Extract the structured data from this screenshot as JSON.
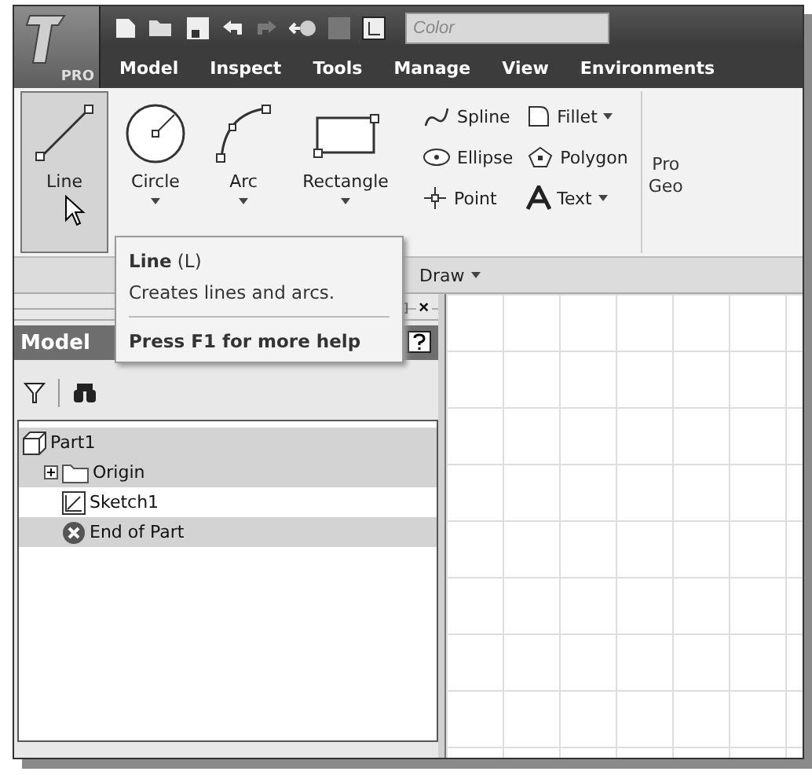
{
  "app_button": {
    "label": "PRO"
  },
  "quick_access": {
    "color_field": {
      "placeholder": "Color"
    }
  },
  "tabs": [
    {
      "label": "Model"
    },
    {
      "label": "Inspect"
    },
    {
      "label": "Tools"
    },
    {
      "label": "Manage"
    },
    {
      "label": "View"
    },
    {
      "label": "Environments"
    }
  ],
  "ribbon": {
    "large_tools": [
      {
        "label": "Line",
        "kind": "line",
        "selected": true
      },
      {
        "label": "Circle",
        "kind": "circle",
        "selected": false
      },
      {
        "label": "Arc",
        "kind": "arc",
        "selected": false
      },
      {
        "label": "Rectangle",
        "kind": "rectangle",
        "selected": false
      }
    ],
    "small_tools": [
      {
        "label": "Spline",
        "kind": "spline",
        "dropdown": false
      },
      {
        "label": "Fillet",
        "kind": "fillet",
        "dropdown": true
      },
      {
        "label": "Ellipse",
        "kind": "ellipse",
        "dropdown": false
      },
      {
        "label": "Polygon",
        "kind": "polygon",
        "dropdown": false
      },
      {
        "label": "Point",
        "kind": "point",
        "dropdown": false
      },
      {
        "label": "Text",
        "kind": "text",
        "dropdown": true
      }
    ],
    "cut_tool": {
      "line_1": "Pro",
      "line_2": "Geo"
    },
    "panel_label": "Draw"
  },
  "tooltip": {
    "title": "**Line** (L)",
    "description": "Creates lines and arcs.",
    "help": "Press F1 for more help"
  },
  "browser": {
    "title": "Model",
    "close_label": "×",
    "tree": [
      {
        "label": "Part1",
        "kind": "part",
        "highlighted": true,
        "children": [
          {
            "label": "Origin",
            "kind": "folder",
            "highlighted": true,
            "expanded": false
          },
          {
            "label": "Sketch1",
            "kind": "sketch",
            "highlighted": false
          },
          {
            "label": "End of Part",
            "kind": "end",
            "highlighted": true
          }
        ]
      }
    ]
  }
}
